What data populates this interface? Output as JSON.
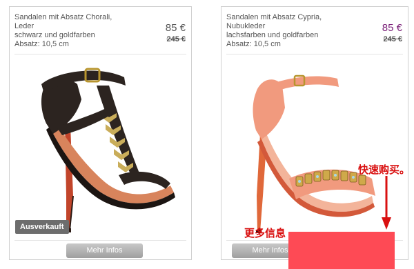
{
  "products": [
    {
      "title_line1": "Sandalen mit Absatz Chorali,",
      "title_line2": "Leder",
      "color": "schwarz und goldfarben",
      "heel": "Absatz: 10,5 cm",
      "price": "85 €",
      "old_price": "245 €",
      "badge": "Ausverkauft",
      "button": "Mehr Infos",
      "price_color": "#555555"
    },
    {
      "title_line1": "Sandalen mit Absatz Cypria,",
      "title_line2": "Nubukleder",
      "color": "lachsfarben und goldfarben",
      "heel": "Absatz: 10,5 cm",
      "price": "85 €",
      "old_price": "245 €",
      "button": "Mehr Infos",
      "price_color": "#7a1f78"
    }
  ],
  "annotations": {
    "quick_buy": "快速购买。",
    "more_info": "更多信息"
  },
  "colors": {
    "annotation_red": "#d91010",
    "overlay_block": "#fe4a55"
  },
  "icons": [
    "black-t-strap-sandal-image",
    "salmon-ankle-strap-sandal-image",
    "red-arrow-icon"
  ]
}
